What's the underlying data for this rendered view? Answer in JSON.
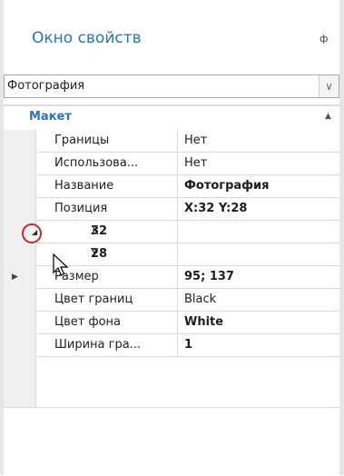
{
  "window": {
    "title": "Окно свойств"
  },
  "selector": {
    "value": "Фотография"
  },
  "category": {
    "label": "Макет"
  },
  "rows": [
    {
      "name": "Границы",
      "value": "Нет",
      "bold": false
    },
    {
      "name": "Использова...",
      "value": "Нет",
      "bold": false
    },
    {
      "name": "Название",
      "value": "Фотография",
      "bold": true
    },
    {
      "name": "Позиция",
      "value": "X:32 Y:28",
      "bold": true
    },
    {
      "name": "X",
      "value": "32",
      "bold": true
    },
    {
      "name": "Y",
      "value": "28",
      "bold": true
    },
    {
      "name": "Размер",
      "value": "95; 137",
      "bold": true
    },
    {
      "name": "Цвет границ",
      "value": "Black",
      "bold": false
    },
    {
      "name": "Цвет фона",
      "value": "White",
      "bold": true
    },
    {
      "name": "Ширина гра...",
      "value": "1",
      "bold": true
    }
  ],
  "colors": {
    "accent": "#2a73b8",
    "highlight_circle": "#c62828",
    "gridline": "#d9d9d9"
  },
  "icons": [
    "pin-icon",
    "dropdown-chevron-icon",
    "collapse-arrow-icon",
    "expander-triangle-icon",
    "mouse-cursor-icon"
  ]
}
